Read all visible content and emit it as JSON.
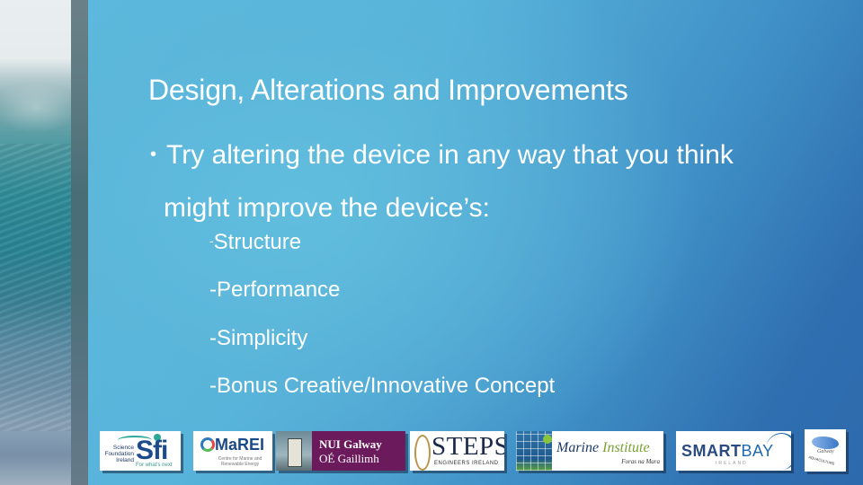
{
  "slide": {
    "title": "Design, Alterations and Improvements",
    "bullet": {
      "marker": "•",
      "line1": "Try altering the device in any way that you think",
      "line2": "might improve the device’s:"
    },
    "subitems": [
      {
        "dash": "-",
        "label": "Structure"
      },
      {
        "label": "-Performance"
      },
      {
        "label": "-Simplicity"
      },
      {
        "label": "-Bonus  Creative/Innovative Concept"
      }
    ]
  },
  "colors": {
    "background_light": "#5dbbdd",
    "background_dark": "#2d6aad",
    "text": "#ffffff"
  },
  "logos": {
    "sfi": {
      "small_lines": "Science Foundation Ireland",
      "big": "Sfi",
      "tagline": "For what's next"
    },
    "marei": {
      "name": "MaREI",
      "sub": "Centre for Marine and Renewable Energy"
    },
    "nui": {
      "line1": "NUI Galway",
      "line2": "OÉ Gaillimh"
    },
    "steps": {
      "name": "STEPS",
      "sub": "ENGINEERS IRELAND"
    },
    "marine_institute": {
      "name1": "Marine",
      "name2": "Institute",
      "sub": "Foras na Mara"
    },
    "smartbay": {
      "name1": "SMART",
      "name2": "BAY",
      "sub": "IRELAND"
    },
    "galway_aquaculture": {
      "script": "Galway",
      "sub": "AQUACULTURE"
    }
  }
}
